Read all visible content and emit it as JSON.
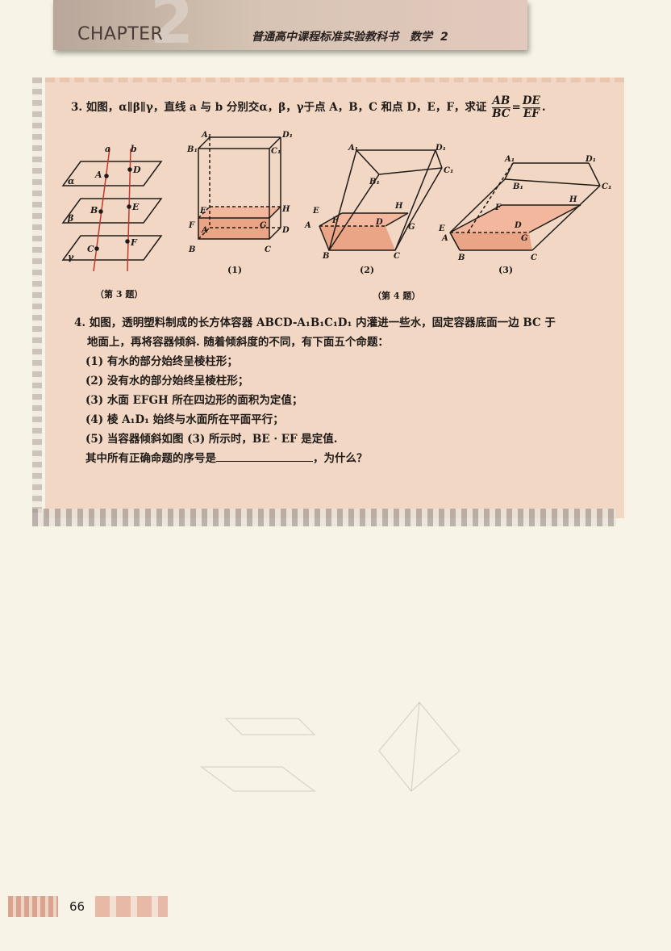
{
  "header": {
    "chapter_word": "CHAPTER",
    "chapter_number": "2",
    "book_title": "普通高中课程标准实验教科书",
    "subject": "数学",
    "volume": "2"
  },
  "q3": {
    "text": "3. 如图，α∥β∥γ，直线 a 与 b 分别交α，β，γ于点 A，B，C 和点 D，E，F，求证",
    "frac1_top": "AB",
    "frac1_bottom": "BC",
    "equals": "=",
    "frac2_top": "DE",
    "frac2_bottom": "EF",
    "end": "."
  },
  "figures": {
    "caption_q3": "（第 3 题）",
    "caption_q4": "（第 4 题）",
    "sub1": "(1)",
    "sub2": "(2)",
    "sub3": "(3)"
  },
  "q4": {
    "stem1": "4. 如图，透明塑料制成的长方体容器 ABCD-A₁B₁C₁D₁ 内灌进一些水，固定容器底面一边 BC 于",
    "stem2": "地面上，再将容器倾斜. 随着倾斜度的不同，有下面五个命题：",
    "items": [
      "(1) 有水的部分始终呈棱柱形；",
      "(2) 没有水的部分始终呈棱柱形；",
      "(3) 水面 EFGH 所在四边形的面积为定值；",
      "(4) 棱 A₁D₁ 始终与水面所在平面平行；",
      "(5) 当容器倾斜如图 (3) 所示时，BE · EF 是定值."
    ],
    "ask_prefix": "其中所有正确命题的序号是",
    "ask_suffix": "，为什么？"
  },
  "footer": {
    "page_number": "66"
  }
}
